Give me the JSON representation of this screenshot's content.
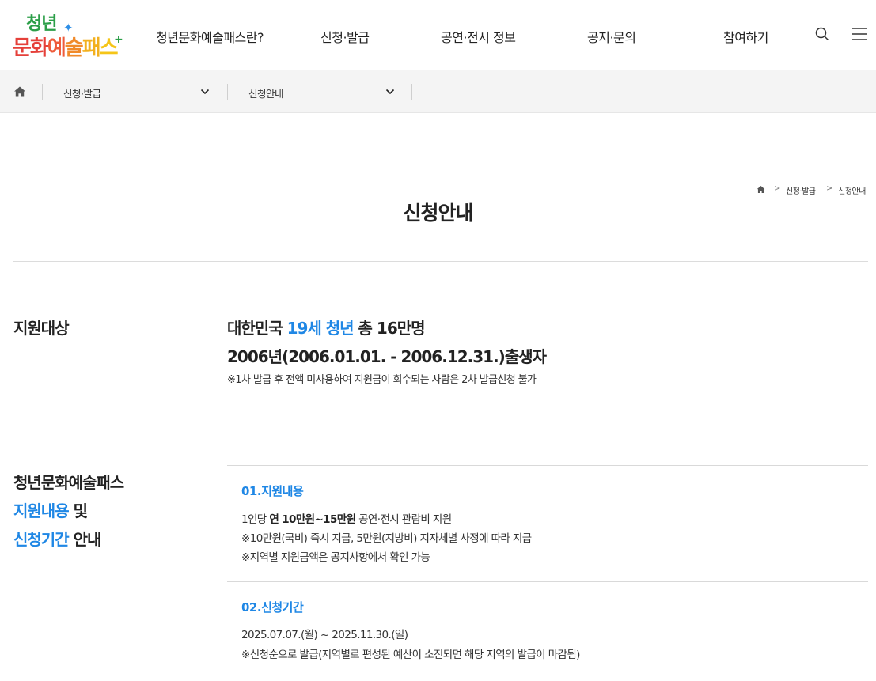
{
  "logo": {
    "line1": "청년",
    "line2": [
      "문",
      "화",
      "예",
      "술",
      "패",
      "스"
    ]
  },
  "gnb": [
    "청년문화예술패스란?",
    "신청·발급",
    "공연·전시 정보",
    "공지·문의",
    "참여하기"
  ],
  "icons": {
    "search": "search-icon",
    "menu": "hamburger-menu-icon",
    "home": "home-icon",
    "chevron": "chevron-down-icon"
  },
  "subnav": {
    "depth1": "신청·발급",
    "depth2": "신청안내"
  },
  "page": {
    "title": "신청안내",
    "breadcrumb": [
      "신청·발급",
      "신청안내"
    ]
  },
  "target": {
    "label": "지원대상",
    "line1_pre": "대한민국 ",
    "line1_highlight": "19세 청년",
    "line1_post": " 총 16만명",
    "line2": "2006년(2006.01.01. - 2006.12.31.)출생자",
    "note": "※1차 발급 후 전액 미사용하여 지원금이 회수되는 사람은 2차 발급신청 불가"
  },
  "info": {
    "label_line1": "청년문화예술패스",
    "label_line2_highlight": "지원내용",
    "label_line2_rest": " 및",
    "label_line3_highlight": "신청기간",
    "label_line3_rest": " 안내",
    "box1": {
      "title": "01.지원내용",
      "line1_pre": "1인당 ",
      "line1_bold": "연 10만원~15만원",
      "line1_post": " 공연·전시 관람비 지원",
      "line2": "※10만원(국비) 즉시 지급, 5만원(지방비) 지자체별 사정에 따라 지급",
      "line3": "※지역별 지원금액은 공지사항에서 확인 가능"
    },
    "box2": {
      "title": "02.신청기간",
      "line1": "2025.07.07.(월) ~ 2025.11.30.(일)",
      "line2": "※신청순으로 발급(지역별로 편성된 예산이 소진되면 해당 지역의 발급이 마감됨)"
    }
  },
  "colors": {
    "accent_blue": "#1f87e5",
    "logo_green": "#2b9e48",
    "logo_red": "#e5403a",
    "logo_yellow": "#f5c518",
    "subnav_bg": "#f4f4f4"
  }
}
